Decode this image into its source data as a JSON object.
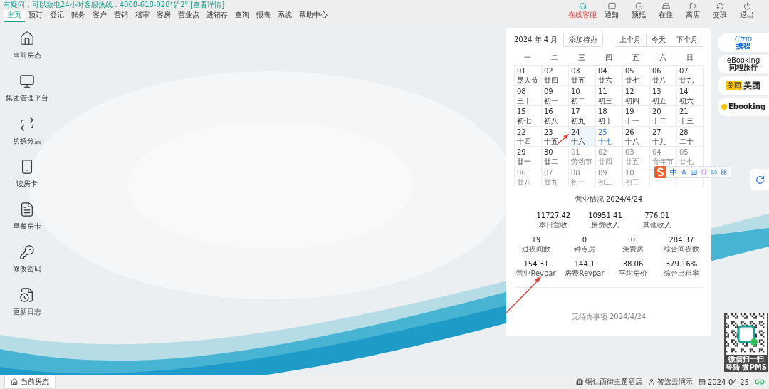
{
  "notice": {
    "text": "有疑问，可以致电24小时客服热线：4008-618-028转\"2\"",
    "link": "[查看详情]"
  },
  "nav_tabs": [
    {
      "label": "主页",
      "selected": true
    },
    {
      "label": "预订",
      "selected": false
    },
    {
      "label": "登记",
      "selected": false
    },
    {
      "label": "账务",
      "selected": false
    },
    {
      "label": "客户",
      "selected": false
    },
    {
      "label": "营销",
      "selected": false
    },
    {
      "label": "稽审",
      "selected": false
    },
    {
      "label": "客房",
      "selected": false
    },
    {
      "label": "营业点",
      "selected": false
    },
    {
      "label": "进销存",
      "selected": false
    },
    {
      "label": "查询",
      "selected": false
    },
    {
      "label": "报表",
      "selected": false
    },
    {
      "label": "系统",
      "selected": false
    },
    {
      "label": "帮助中心",
      "selected": false
    }
  ],
  "toolbar": [
    {
      "label": "在线客服",
      "kind": "support",
      "highlighted": true
    },
    {
      "label": "通知",
      "kind": "notice",
      "highlighted": false
    },
    {
      "label": "预抵",
      "kind": "arrival",
      "highlighted": false
    },
    {
      "label": "在住",
      "kind": "stay",
      "highlighted": false
    },
    {
      "label": "离店",
      "kind": "leave",
      "highlighted": false
    },
    {
      "label": "交班",
      "kind": "shift",
      "highlighted": false
    },
    {
      "label": "退出",
      "kind": "logout",
      "highlighted": false
    }
  ],
  "sidebar": {
    "items": [
      {
        "label": "当前房态",
        "kind": "house"
      },
      {
        "label": "集团管理平台",
        "kind": "monitor"
      },
      {
        "label": "切换分店",
        "kind": "switch"
      },
      {
        "label": "读房卡",
        "kind": "card"
      },
      {
        "label": "早餐房卡",
        "kind": "breakfast"
      },
      {
        "label": "修改密码",
        "kind": "key"
      },
      {
        "label": "更新日志",
        "kind": "log"
      }
    ]
  },
  "calendar": {
    "title": "2024 年 4 月",
    "add_button": "添加待办",
    "nav_buttons": [
      "上个月",
      "今天",
      "下个月"
    ],
    "weekdays": [
      "一",
      "二",
      "三",
      "四",
      "五",
      "六",
      "日"
    ],
    "weeks": [
      [
        {
          "day": "01",
          "lunar": "愚人节",
          "in_month": true,
          "selected": false,
          "today": false
        },
        {
          "day": "02",
          "lunar": "廿四",
          "in_month": true,
          "selected": false,
          "today": false
        },
        {
          "day": "03",
          "lunar": "廿五",
          "in_month": true,
          "selected": false,
          "today": false
        },
        {
          "day": "04",
          "lunar": "廿六",
          "in_month": true,
          "selected": false,
          "today": false
        },
        {
          "day": "05",
          "lunar": "廿七",
          "in_month": true,
          "selected": false,
          "today": false
        },
        {
          "day": "06",
          "lunar": "廿八",
          "in_month": true,
          "selected": false,
          "today": false
        },
        {
          "day": "07",
          "lunar": "廿九",
          "in_month": true,
          "selected": false,
          "today": false
        }
      ],
      [
        {
          "day": "08",
          "lunar": "三十",
          "in_month": true,
          "selected": false,
          "today": false
        },
        {
          "day": "09",
          "lunar": "初一",
          "in_month": true,
          "selected": false,
          "today": false
        },
        {
          "day": "10",
          "lunar": "初二",
          "in_month": true,
          "selected": false,
          "today": false
        },
        {
          "day": "11",
          "lunar": "初三",
          "in_month": true,
          "selected": false,
          "today": false
        },
        {
          "day": "12",
          "lunar": "初四",
          "in_month": true,
          "selected": false,
          "today": false
        },
        {
          "day": "13",
          "lunar": "初五",
          "in_month": true,
          "selected": false,
          "today": false
        },
        {
          "day": "14",
          "lunar": "初六",
          "in_month": true,
          "selected": false,
          "today": false
        }
      ],
      [
        {
          "day": "15",
          "lunar": "初七",
          "in_month": true,
          "selected": false,
          "today": false
        },
        {
          "day": "16",
          "lunar": "初八",
          "in_month": true,
          "selected": false,
          "today": false
        },
        {
          "day": "17",
          "lunar": "初九",
          "in_month": true,
          "selected": false,
          "today": false
        },
        {
          "day": "18",
          "lunar": "初十",
          "in_month": true,
          "selected": false,
          "today": false
        },
        {
          "day": "19",
          "lunar": "十一",
          "in_month": true,
          "selected": false,
          "today": false
        },
        {
          "day": "20",
          "lunar": "十二",
          "in_month": true,
          "selected": false,
          "today": false
        },
        {
          "day": "21",
          "lunar": "十三",
          "in_month": true,
          "selected": false,
          "today": false
        }
      ],
      [
        {
          "day": "22",
          "lunar": "十四",
          "in_month": true,
          "selected": false,
          "today": false
        },
        {
          "day": "23",
          "lunar": "十五",
          "in_month": true,
          "selected": false,
          "today": false
        },
        {
          "day": "24",
          "lunar": "十六",
          "in_month": true,
          "selected": true,
          "today": false
        },
        {
          "day": "25",
          "lunar": "十七",
          "in_month": true,
          "selected": false,
          "today": true
        },
        {
          "day": "26",
          "lunar": "十八",
          "in_month": true,
          "selected": false,
          "today": false
        },
        {
          "day": "27",
          "lunar": "十九",
          "in_month": true,
          "selected": false,
          "today": false
        },
        {
          "day": "28",
          "lunar": "二十",
          "in_month": true,
          "selected": false,
          "today": false
        }
      ],
      [
        {
          "day": "29",
          "lunar": "廿一",
          "in_month": true,
          "selected": false,
          "today": false
        },
        {
          "day": "30",
          "lunar": "廿二",
          "in_month": true,
          "selected": false,
          "today": false
        },
        {
          "day": "01",
          "lunar": "劳动节",
          "in_month": false,
          "selected": false,
          "today": false
        },
        {
          "day": "02",
          "lunar": "廿四",
          "in_month": false,
          "selected": false,
          "today": false
        },
        {
          "day": "03",
          "lunar": "廿五",
          "in_month": false,
          "selected": false,
          "today": false
        },
        {
          "day": "04",
          "lunar": "青年节",
          "in_month": false,
          "selected": false,
          "today": false
        },
        {
          "day": "05",
          "lunar": "廿七",
          "in_month": false,
          "selected": false,
          "today": false
        }
      ],
      [
        {
          "day": "06",
          "lunar": "廿八",
          "in_month": false,
          "selected": false,
          "today": false
        },
        {
          "day": "07",
          "lunar": "廿九",
          "in_month": false,
          "selected": false,
          "today": false
        },
        {
          "day": "08",
          "lunar": "初一",
          "in_month": false,
          "selected": false,
          "today": false
        },
        {
          "day": "09",
          "lunar": "初二",
          "in_month": false,
          "selected": false,
          "today": false
        },
        {
          "day": "10",
          "lunar": "初三",
          "in_month": false,
          "selected": false,
          "today": false
        }
      ]
    ]
  },
  "business": {
    "title": "营业情况 2024/4/24",
    "rows": [
      [
        {
          "value": "11727.42",
          "label": "本日营收"
        },
        {
          "value": "10951.41",
          "label": "房费收入"
        },
        {
          "value": "776.01",
          "label": "其他收入"
        }
      ],
      [
        {
          "value": "19",
          "label": "过夜间数"
        },
        {
          "value": "0",
          "label": "钟点房"
        },
        {
          "value": "0",
          "label": "免费房"
        },
        {
          "value": "284.37",
          "label": "综合间夜数"
        }
      ],
      [
        {
          "value": "154.31",
          "label": "营业Revpar"
        },
        {
          "value": "144.1",
          "label": "房费Revpar"
        },
        {
          "value": "38.06",
          "label": "平均房价"
        },
        {
          "value": "379.16%",
          "label": "综合出租率"
        }
      ]
    ]
  },
  "todo": {
    "text": "无待办事项 2024/4/24"
  },
  "ime_toolbar": {
    "mode": "中"
  },
  "partners": [
    {
      "kind": "ctrip",
      "top": "Ctrip",
      "label": "携程"
    },
    {
      "kind": "tongcheng",
      "top": "eBooking",
      "label": "同程旅行"
    },
    {
      "kind": "meituan",
      "top": "美团",
      "label": "美团"
    },
    {
      "kind": "ebooking",
      "label": "Ebooking"
    }
  ],
  "qr": {
    "lines": [
      "微信扫一扫",
      "登陆 微PMS"
    ]
  },
  "status_bar": {
    "button": "当前房态",
    "hotel": "铜仁西街主题酒店",
    "user": "智选云演示",
    "date": "2024-04-25"
  }
}
